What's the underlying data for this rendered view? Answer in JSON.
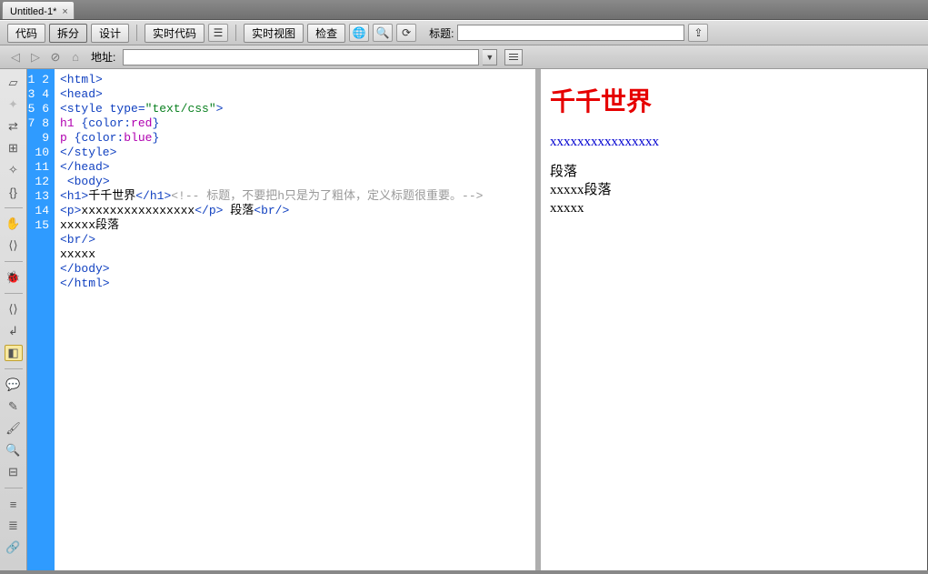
{
  "tab": {
    "title": "Untitled-1*",
    "close": "×"
  },
  "toolbar": {
    "code": "代码",
    "split": "拆分",
    "design": "设计",
    "live_code": "实时代码",
    "live_view": "实时视图",
    "inspect": "检查",
    "title_label": "标题:",
    "title_value": ""
  },
  "addressbar": {
    "label": "地址:",
    "value": ""
  },
  "code": {
    "lines": [
      {
        "n": "1",
        "html": "<span class='tag'>&lt;html&gt;</span>"
      },
      {
        "n": "2",
        "html": "<span class='tag'>&lt;head&gt;</span>"
      },
      {
        "n": "3",
        "html": "<span class='tag'>&lt;style</span> <span class='attr'>type=</span><span class='val'>\"text/css\"</span><span class='tag'>&gt;</span>"
      },
      {
        "n": "4",
        "html": "<span class='css-sel'>h1</span> <span class='css-brace'>{</span><span class='css-prop'>color:</span><span class='css-val'>red</span><span class='css-brace'>}</span>"
      },
      {
        "n": "5",
        "html": "<span class='css-sel'>p</span> <span class='css-brace'>{</span><span class='css-prop'>color:</span><span class='css-val'>blue</span><span class='css-brace'>}</span>"
      },
      {
        "n": "6",
        "html": "<span class='tag'>&lt;/style&gt;</span>"
      },
      {
        "n": "7",
        "html": "<span class='tag'>&lt;/head&gt;</span>"
      },
      {
        "n": "8",
        "html": " <span class='tag'>&lt;body&gt;</span>"
      },
      {
        "n": "9",
        "html": "<span class='tag'>&lt;h1&gt;</span><span class='txt'>千千世界</span><span class='tag'>&lt;/h1&gt;</span><span class='cmt'>&lt;!-- 标题，不要把h只是为了粗体，定义标题很重要。--&gt;</span>"
      },
      {
        "n": "10",
        "html": "<span class='tag'>&lt;p&gt;</span><span class='txt'>xxxxxxxxxxxxxxxx</span><span class='tag'>&lt;/p&gt;</span> <span class='txt'>段落</span><span class='tag'>&lt;br/&gt;</span>"
      },
      {
        "n": "11",
        "html": "<span class='txt'>xxxxx段落</span>"
      },
      {
        "n": "12",
        "html": "<span class='tag'>&lt;br/&gt;</span>"
      },
      {
        "n": "13",
        "html": "<span class='txt'>xxxxx</span>"
      },
      {
        "n": "14",
        "html": "<span class='tag'>&lt;/body&gt;</span>"
      },
      {
        "n": "15",
        "html": "<span class='tag'>&lt;/html&gt;</span>"
      }
    ]
  },
  "preview": {
    "h1": "千千世界",
    "p": "xxxxxxxxxxxxxxxx",
    "line1": "段落",
    "line2": "xxxxx段落",
    "line3": "xxxxx"
  }
}
